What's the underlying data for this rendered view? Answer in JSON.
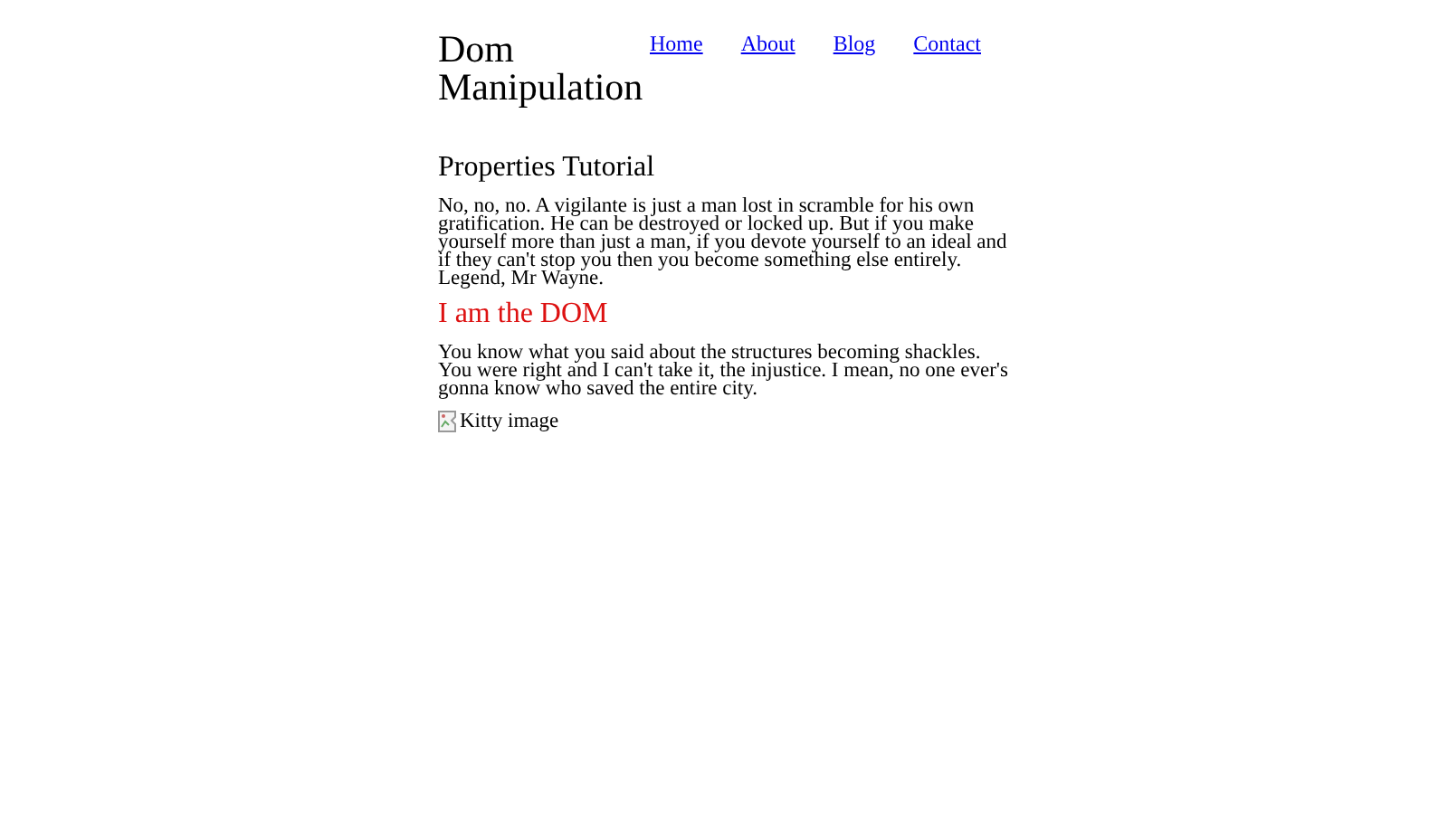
{
  "header": {
    "title": "Dom Manipulation",
    "nav": [
      {
        "label": "Home"
      },
      {
        "label": "About"
      },
      {
        "label": "Blog"
      },
      {
        "label": "Contact"
      }
    ]
  },
  "sections": [
    {
      "heading": "Properties Tutorial",
      "kind": "plain",
      "text": "No, no, no. A vigilante is just a man lost in scramble for his own gratification. He can be destroyed or locked up. But if you make yourself more than just a man, if you devote yourself to an ideal and if they can't stop you then you become something else entirely. Legend, Mr Wayne."
    },
    {
      "heading": "I am the DOM",
      "kind": "red",
      "text": "You know what you said about the structures becoming shackles. You were right and I can't take it, the injustice. I mean, no one ever's gonna know who saved the entire city."
    }
  ],
  "image": {
    "alt": "Kitty image"
  }
}
